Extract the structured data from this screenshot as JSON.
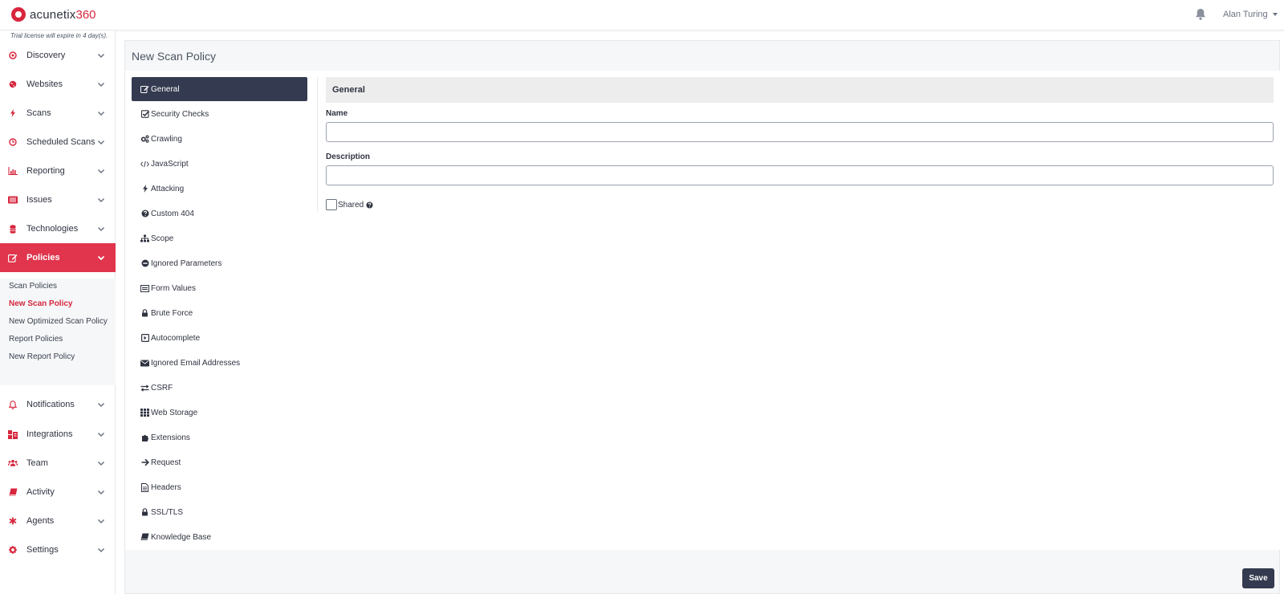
{
  "header": {
    "logo_text": "acunetix",
    "logo_suffix": "360",
    "user_name": "Alan Turing"
  },
  "sidebar": {
    "trial_notice": "Trial license will expire in 4 day(s).",
    "items": [
      {
        "label": "Discovery",
        "icon": "discovery-icon"
      },
      {
        "label": "Websites",
        "icon": "globe-icon"
      },
      {
        "label": "Scans",
        "icon": "bolt-icon"
      },
      {
        "label": "Scheduled Scans",
        "icon": "clock-icon"
      },
      {
        "label": "Reporting",
        "icon": "bar-chart-icon"
      },
      {
        "label": "Issues",
        "icon": "list-icon"
      },
      {
        "label": "Technologies",
        "icon": "database-icon"
      },
      {
        "label": "Policies",
        "icon": "edit-icon",
        "active": true
      },
      {
        "label": "Notifications",
        "icon": "bell-icon"
      },
      {
        "label": "Integrations",
        "icon": "integrations-icon"
      },
      {
        "label": "Team",
        "icon": "users-icon"
      },
      {
        "label": "Activity",
        "icon": "book-icon"
      },
      {
        "label": "Agents",
        "icon": "asterisk-icon"
      },
      {
        "label": "Settings",
        "icon": "gear-icon"
      }
    ],
    "policies_sub": [
      {
        "label": "Scan Policies"
      },
      {
        "label": "New Scan Policy",
        "current": true
      },
      {
        "label": "New Optimized Scan Policy"
      },
      {
        "label": "Report Policies"
      },
      {
        "label": "New Report Policy"
      }
    ]
  },
  "main": {
    "page_title": "New Scan Policy",
    "policy_nav": [
      {
        "label": "General",
        "icon": "edit-icon",
        "active": true
      },
      {
        "label": "Security Checks",
        "icon": "check-square-icon"
      },
      {
        "label": "Crawling",
        "icon": "cogs-icon"
      },
      {
        "label": "JavaScript",
        "icon": "code-icon"
      },
      {
        "label": "Attacking",
        "icon": "bolt-icon"
      },
      {
        "label": "Custom 404",
        "icon": "question-circle-icon"
      },
      {
        "label": "Scope",
        "icon": "sitemap-icon"
      },
      {
        "label": "Ignored Parameters",
        "icon": "minus-circle-icon"
      },
      {
        "label": "Form Values",
        "icon": "form-icon"
      },
      {
        "label": "Brute Force",
        "icon": "lock-icon"
      },
      {
        "label": "Autocomplete",
        "icon": "caret-square-icon"
      },
      {
        "label": "Ignored Email Addresses",
        "icon": "envelope-icon"
      },
      {
        "label": "CSRF",
        "icon": "exchange-icon"
      },
      {
        "label": "Web Storage",
        "icon": "grid-icon"
      },
      {
        "label": "Extensions",
        "icon": "puzzle-icon"
      },
      {
        "label": "Request",
        "icon": "arrow-right-icon"
      },
      {
        "label": "Headers",
        "icon": "file-icon"
      },
      {
        "label": "SSL/TLS",
        "icon": "lock-icon"
      },
      {
        "label": "Knowledge Base",
        "icon": "book-icon"
      }
    ],
    "section_title": "General",
    "name_label": "Name",
    "name_value": "",
    "description_label": "Description",
    "description_value": "",
    "shared_label": "Shared",
    "shared_checked": false,
    "save_label": "Save"
  },
  "colors": {
    "accent": "#d7263d",
    "active_sidebar": "#e0354d",
    "dark_button": "#343a4f"
  }
}
